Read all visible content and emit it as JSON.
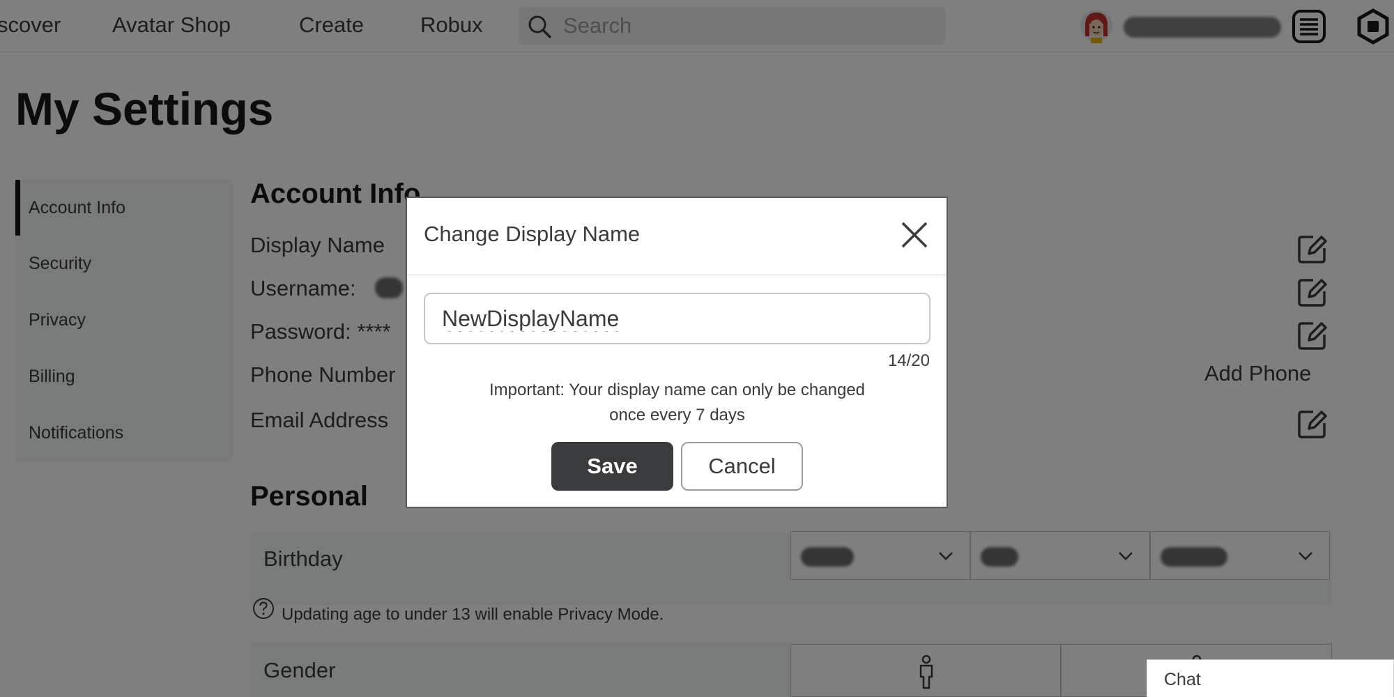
{
  "nav": {
    "links": [
      "scover",
      "Avatar Shop",
      "Create",
      "Robux"
    ],
    "search_placeholder": "Search"
  },
  "page": {
    "title": "My Settings"
  },
  "sidebar": {
    "items": [
      {
        "label": "Account Info"
      },
      {
        "label": "Security"
      },
      {
        "label": "Privacy"
      },
      {
        "label": "Billing"
      },
      {
        "label": "Notifications"
      }
    ]
  },
  "account": {
    "section_title": "Account Info",
    "display_name_label": "Display Name",
    "username_label": "Username:",
    "password_label": "Password: ****",
    "phone_label": "Phone Number",
    "email_label": "Email Address",
    "add_phone": "Add Phone"
  },
  "personal": {
    "section_title": "Personal",
    "birthday_label": "Birthday",
    "privacy_note": "Updating age to under 13 will enable Privacy Mode.",
    "gender_label": "Gender"
  },
  "modal": {
    "title": "Change Display Name",
    "input_value": "NewDisplayName",
    "char_count": "14/20",
    "important_line1": "Important: Your display name can only be changed",
    "important_line2": "once every 7 days",
    "save_label": "Save",
    "cancel_label": "Cancel"
  },
  "chat": {
    "label": "Chat"
  },
  "colors": {
    "accent_dark": "#393b3d",
    "overlay": "rgba(0,0,0,0.5)"
  }
}
